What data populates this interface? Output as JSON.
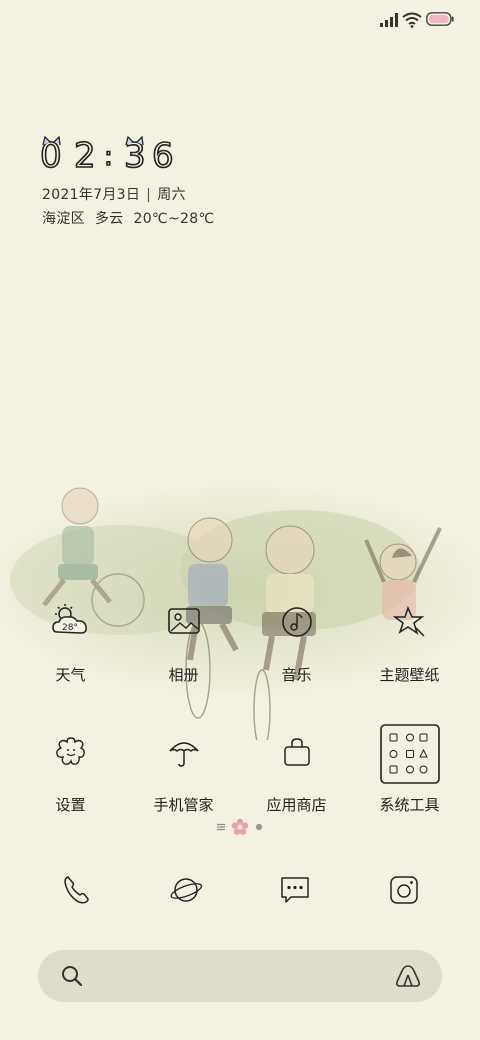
{
  "clock": {
    "digits": [
      "0",
      "2",
      ":",
      "3",
      "6"
    ]
  },
  "date": {
    "date_text": "2021年7月3日",
    "weekday": "周六"
  },
  "weather": {
    "district": "海淀区",
    "condition": "多云",
    "temp_range": "20℃~28℃"
  },
  "apps": [
    [
      {
        "name": "weather",
        "label": "天气",
        "icon": "weather-icon",
        "icon_text": "28°"
      },
      {
        "name": "gallery",
        "label": "相册",
        "icon": "gallery-icon"
      },
      {
        "name": "music",
        "label": "音乐",
        "icon": "music-icon"
      },
      {
        "name": "themes",
        "label": "主题壁纸",
        "icon": "theme-star-icon"
      }
    ],
    [
      {
        "name": "settings",
        "label": "设置",
        "icon": "settings-flower-icon"
      },
      {
        "name": "security",
        "label": "手机管家",
        "icon": "umbrella-icon"
      },
      {
        "name": "app-store",
        "label": "应用商店",
        "icon": "shopping-bag-icon"
      },
      {
        "name": "system-tools",
        "label": "系统工具",
        "icon": "folder-grid-icon"
      }
    ]
  ],
  "dock": [
    "phone-icon",
    "browser-planet-icon",
    "messages-icon",
    "camera-icon"
  ],
  "page_indicator": {
    "pages": 2,
    "current": 1
  },
  "colors": {
    "background": "#f3f1e1",
    "search_bg": "#dedcca",
    "accent_pink": "#e7a3a3",
    "battery_pink": "#f2b4c0"
  }
}
